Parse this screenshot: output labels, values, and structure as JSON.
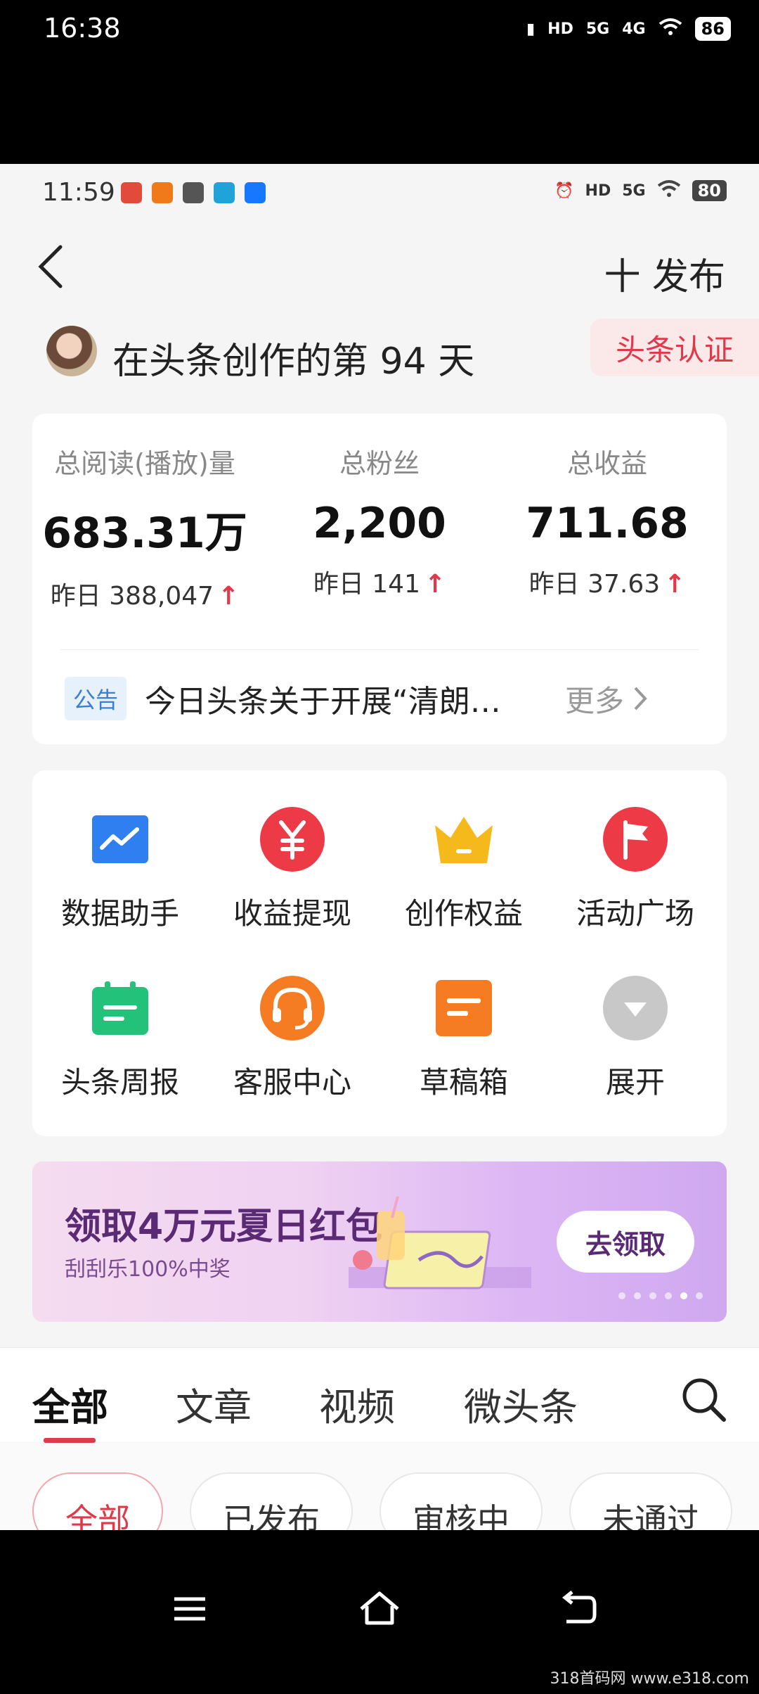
{
  "outer_status": {
    "time": "16:38",
    "battery": "86",
    "net1": "5G",
    "net2": "4G",
    "hd": "HD"
  },
  "inner_status": {
    "time": "11:59",
    "battery": "80",
    "net": "5G",
    "hd": "HD"
  },
  "header": {
    "publish_label": "十 发布"
  },
  "creator": {
    "text": "在头条创作的第 94 天",
    "cert_label": "头条认证"
  },
  "stats": [
    {
      "label": "总阅读(播放)量",
      "value": "683.31万",
      "sub": "昨日 388,047"
    },
    {
      "label": "总粉丝",
      "value": "2,200",
      "sub": "昨日 141"
    },
    {
      "label": "总收益",
      "value": "711.68",
      "sub": "昨日 37.63"
    }
  ],
  "notice": {
    "tag": "公告",
    "text": "今日头条关于开展“清朗…",
    "more": "更多"
  },
  "tools": [
    {
      "label": "数据助手",
      "icon": "chart-icon",
      "color": "#2f7ff0"
    },
    {
      "label": "收益提现",
      "icon": "yuan-icon",
      "color": "#ec3b47"
    },
    {
      "label": "创作权益",
      "icon": "crown-icon",
      "color": "#f6b91b"
    },
    {
      "label": "活动广场",
      "icon": "flag-icon",
      "color": "#ec3b47"
    },
    {
      "label": "头条周报",
      "icon": "calendar-icon",
      "color": "#22c27a"
    },
    {
      "label": "客服中心",
      "icon": "headset-icon",
      "color": "#f57c22"
    },
    {
      "label": "草稿箱",
      "icon": "draft-icon",
      "color": "#f57c22"
    },
    {
      "label": "展开",
      "icon": "expand-icon",
      "color": "#bdbdbd"
    }
  ],
  "banner": {
    "title": "领取4万元夏日红包",
    "subtitle": "刮刮乐100%中奖",
    "button": "去领取"
  },
  "tabs": [
    "全部",
    "文章",
    "视频",
    "微头条"
  ],
  "filters": [
    "全部",
    "已发布",
    "审核中",
    "未通过"
  ],
  "watermark": "318首码网 www.e318.com"
}
